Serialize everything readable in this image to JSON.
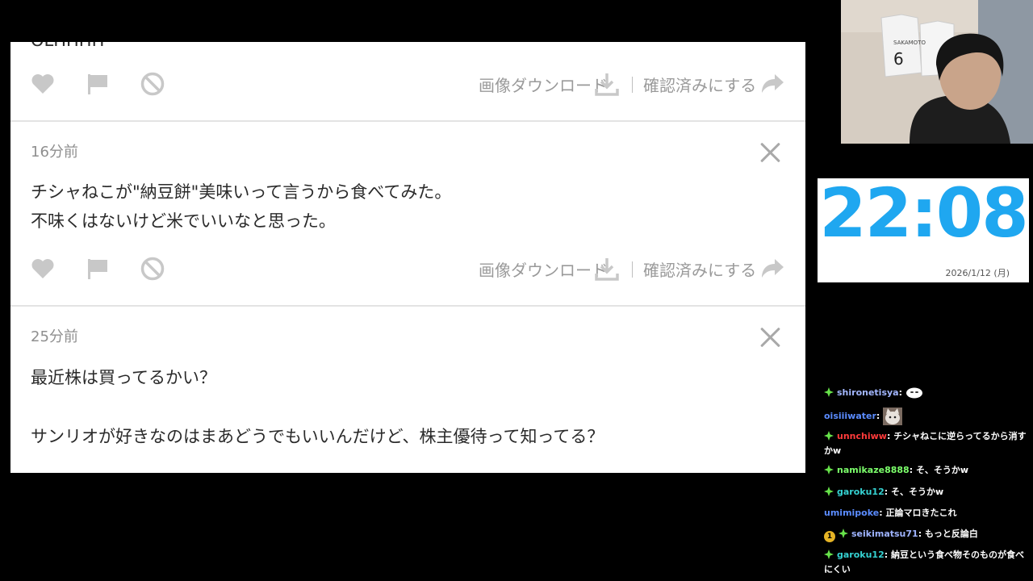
{
  "panel": {
    "cards": [
      {
        "time": "",
        "message_lines": [
          "OLHHHH"
        ],
        "download_label": "画像ダウンロード",
        "confirm_label": "確認済みにする"
      },
      {
        "time": "16分前",
        "message_lines": [
          "チシャねこが\"納豆餅\"美味いって言うから食べてみた。",
          "不味くはないけど米でいいなと思った。"
        ],
        "download_label": "画像ダウンロード",
        "confirm_label": "確認済みにする"
      },
      {
        "time": "25分前",
        "message_lines": [
          "最近株は買ってるかい？",
          "",
          "サンリオが好きなのはまあどうでもいいんだけど、株主優待って知ってる？"
        ]
      }
    ],
    "icons": {
      "like": "heart-icon",
      "report": "flag-icon",
      "block": "block-icon",
      "download": "download-icon",
      "confirm": "share-arrow-icon",
      "close": "close-icon"
    }
  },
  "webcam": {
    "jersey_text": "SAKAMOTO",
    "jersey_number": "6"
  },
  "clock": {
    "time": "22:08",
    "date": "2026/1/12 (月)",
    "color": "#1fa7f0"
  },
  "chat": {
    "messages": [
      {
        "user": "shironetisya",
        "user_color": "#a3b7ff",
        "text": "",
        "emote": "ghost-emote",
        "sparkle": true,
        "sub_badge": ""
      },
      {
        "user": "oisiiiwater",
        "user_color": "#5b8cff",
        "text": "",
        "emote": "cat-emote",
        "sparkle": false,
        "sub_badge": ""
      },
      {
        "user": "unnchiww",
        "user_color": "#ff3b3b",
        "text": "チシャねこに逆らってるから消すかw",
        "emote": "",
        "sparkle": true,
        "sub_badge": ""
      },
      {
        "user": "namikaze8888",
        "user_color": "#7cff6b",
        "text": "そ、そうかw",
        "emote": "",
        "sparkle": true,
        "sub_badge": ""
      },
      {
        "user": "garoku12",
        "user_color": "#35d2d2",
        "text": "そ、そうかw",
        "emote": "",
        "sparkle": true,
        "sub_badge": ""
      },
      {
        "user": "umimipoke",
        "user_color": "#5b8cff",
        "text": "正論マロきたこれ",
        "emote": "",
        "sparkle": false,
        "sub_badge": ""
      },
      {
        "user": "seikimatsu71",
        "user_color": "#9fb4ff",
        "text": "もっと反論白",
        "emote": "",
        "sparkle": true,
        "sub_badge": "1"
      },
      {
        "user": "garoku12",
        "user_color": "#35d2d2",
        "text": "納豆という食べ物そのものが食べにくい",
        "emote": "",
        "sparkle": true,
        "sub_badge": ""
      }
    ]
  }
}
